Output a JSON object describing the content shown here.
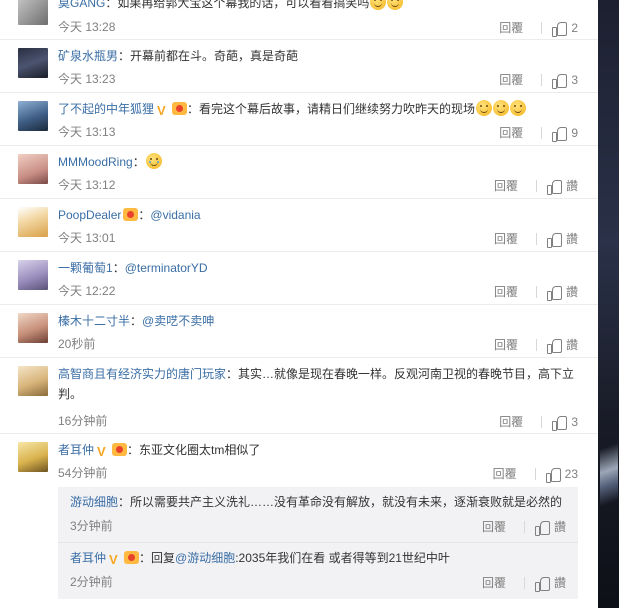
{
  "comments": [
    {
      "user": "莫GANG",
      "text": "：如果再给郭大宝这个幕我的话，可以看看搞笑吗",
      "time": "今天 13:28",
      "reply": "回覆",
      "likes": "2",
      "avatar_icon": "avatar-gray"
    },
    {
      "user": "矿泉水瓶男",
      "text": "：开幕前都在斗。奇葩，真是奇葩",
      "time": "今天 13:23",
      "reply": "回覆",
      "likes": "3",
      "avatar_icon": "avatar-dark"
    },
    {
      "user": "了不起的中年狐狸",
      "text": "：看完这个幕后故事，请精日们继续努力吹昨天的现场",
      "time": "今天 13:13",
      "reply": "回覆",
      "likes": "9",
      "avatar_icon": "avatar-jet"
    },
    {
      "user": "MMMoodRing",
      "text": "：",
      "time": "今天 13:12",
      "reply": "回覆",
      "likes": "讚",
      "avatar_icon": "avatar-pink"
    },
    {
      "user": "PoopDealer",
      "text": "：",
      "mention": "@vidania",
      "time": "今天 13:01",
      "reply": "回覆",
      "likes": "讚",
      "avatar_icon": "avatar-dog"
    },
    {
      "user": "一颗葡萄1",
      "text": "：",
      "mention": "@terminatorYD",
      "time": "今天 12:22",
      "reply": "回覆",
      "likes": "讚",
      "avatar_icon": "avatar-purple"
    },
    {
      "user": "榛木十二寸半",
      "text": "：",
      "mention": "@卖呓不卖呻",
      "time": "20秒前",
      "reply": "回覆",
      "likes": "讚",
      "avatar_icon": "avatar-girl"
    },
    {
      "user": "高智商且有经济实力的唐门玩家",
      "text": "：其实…就像是现在春晚一样。反观河南卫视的春晚节目，高下立",
      "text2": "判。",
      "time": "16分钟前",
      "reply": "回覆",
      "likes": "3",
      "avatar_icon": "avatar-shiba"
    },
    {
      "user": "者耳仲",
      "text": "：东亚文化圈太tm相似了",
      "time": "54分钟前",
      "reply": "回覆",
      "likes": "23",
      "avatar_icon": "avatar-gold"
    }
  ],
  "subcomments": [
    {
      "user": "游动细胞",
      "text": "：所以需要共产主义洗礼……没有革命没有解放，就没有未来，逐渐衰败就是必然的",
      "time": "3分钟前",
      "reply": "回覆",
      "likes": "讚"
    },
    {
      "user": "者耳仲",
      "text": "：回复",
      "mention": "@游动细胞",
      "text_tail": ":2035年我们在看 或者得等到21世纪中叶",
      "time": "2分钟前",
      "reply": "回覆",
      "likes": "讚"
    }
  ]
}
